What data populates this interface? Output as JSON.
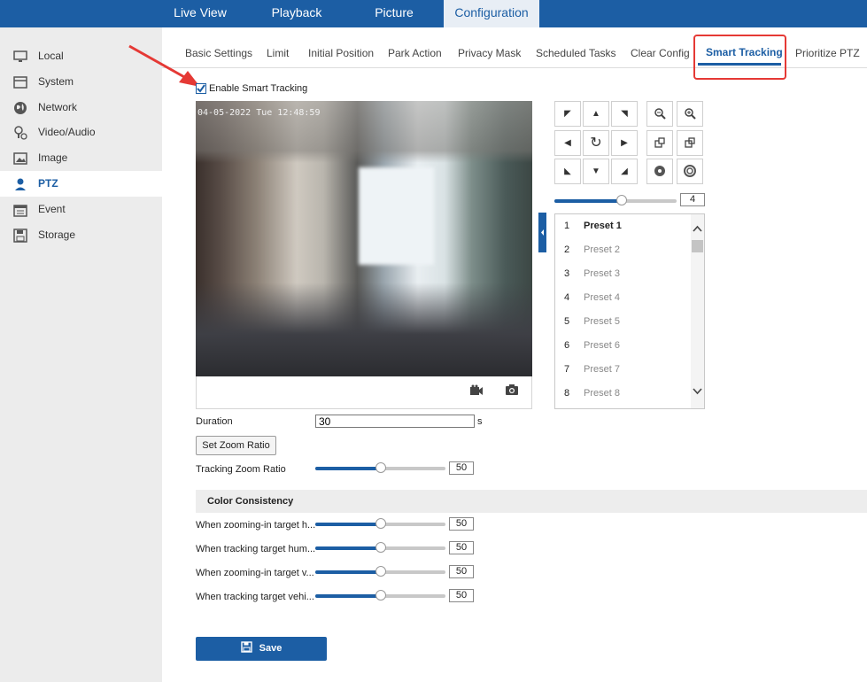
{
  "topnav": {
    "tabs": [
      "Live View",
      "Playback",
      "Picture",
      "Configuration"
    ],
    "active_index": 3
  },
  "sidebar": {
    "items": [
      {
        "label": "Local",
        "icon": "monitor-icon"
      },
      {
        "label": "System",
        "icon": "window-icon"
      },
      {
        "label": "Network",
        "icon": "globe-icon"
      },
      {
        "label": "Video/Audio",
        "icon": "video-audio-icon"
      },
      {
        "label": "Image",
        "icon": "image-icon"
      },
      {
        "label": "PTZ",
        "icon": "ptz-user-icon"
      },
      {
        "label": "Event",
        "icon": "calendar-icon"
      },
      {
        "label": "Storage",
        "icon": "disk-icon"
      }
    ],
    "active_index": 5
  },
  "subtabs": {
    "items": [
      "Basic Settings",
      "Limit",
      "Initial Position",
      "Park Action",
      "Privacy Mask",
      "Scheduled Tasks",
      "Clear Config",
      "Smart Tracking",
      "Prioritize PTZ"
    ],
    "active_index": 7
  },
  "enable_smart_tracking": {
    "label": "Enable Smart Tracking",
    "checked": true
  },
  "video": {
    "osd": "04-05-2022 Tue 12:48:59"
  },
  "ptz": {
    "speed": {
      "value": "4",
      "level": 0.55
    }
  },
  "presets": [
    {
      "num": "1",
      "name": "Preset 1",
      "active": true
    },
    {
      "num": "2",
      "name": "Preset 2",
      "active": false
    },
    {
      "num": "3",
      "name": "Preset 3",
      "active": false
    },
    {
      "num": "4",
      "name": "Preset 4",
      "active": false
    },
    {
      "num": "5",
      "name": "Preset 5",
      "active": false
    },
    {
      "num": "6",
      "name": "Preset 6",
      "active": false
    },
    {
      "num": "7",
      "name": "Preset 7",
      "active": false
    },
    {
      "num": "8",
      "name": "Preset 8",
      "active": false
    }
  ],
  "form": {
    "duration_label": "Duration",
    "duration_value": "30",
    "duration_unit": "s",
    "zoom_button": "Set Zoom Ratio",
    "tracking_zoom_label": "Tracking Zoom Ratio",
    "tracking_zoom_value": "50",
    "tracking_zoom_level": 0.5
  },
  "color_consistency": {
    "title": "Color Consistency",
    "rows": [
      {
        "label": "When zooming-in target h...",
        "value": "50",
        "level": 0.5
      },
      {
        "label": "When tracking target hum...",
        "value": "50",
        "level": 0.5
      },
      {
        "label": "When zooming-in target v...",
        "value": "50",
        "level": 0.5
      },
      {
        "label": "When tracking target vehi...",
        "value": "50",
        "level": 0.5
      }
    ]
  },
  "save_label": "Save",
  "colors": {
    "brand": "#1c5ea4",
    "highlight": "#e53935"
  }
}
